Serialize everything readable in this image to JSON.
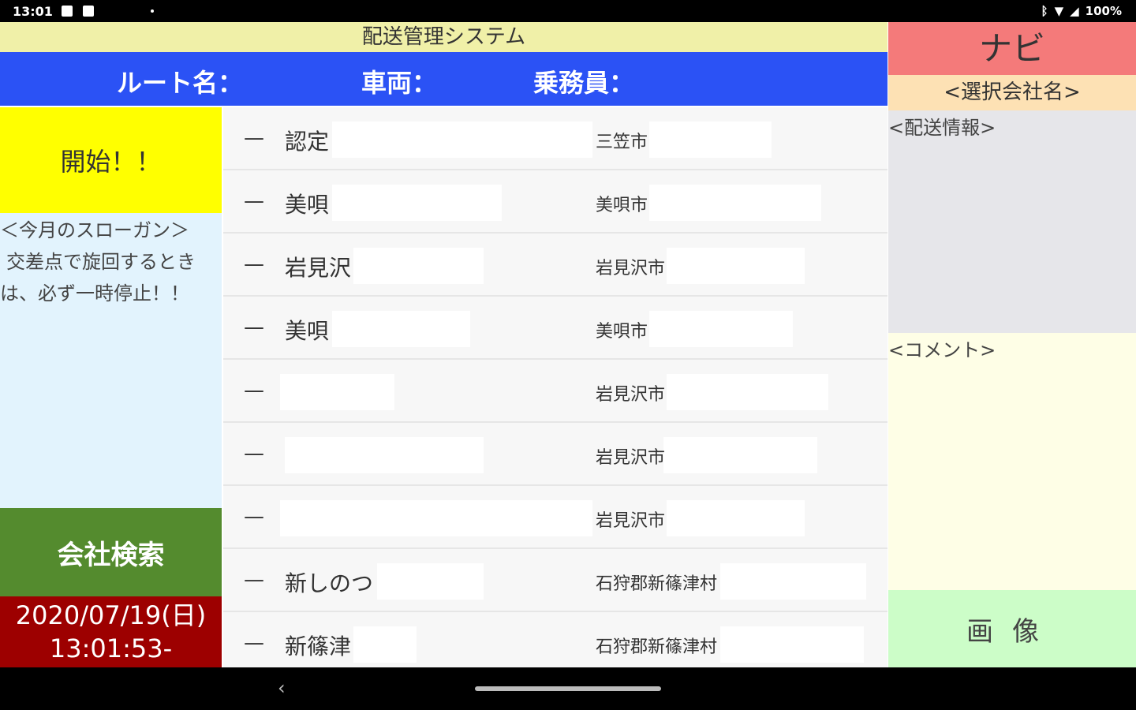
{
  "status_bar": {
    "time": "13:01",
    "battery": "100%"
  },
  "header": {
    "title": "配送管理システム",
    "route_label": "ルート名：",
    "vehicle_label": "車両：",
    "crew_label": "乗務員："
  },
  "left_panel": {
    "start_button": "開始！！",
    "slogan_title": "＜今月のスローガン＞",
    "slogan_line1": "交差点で旋回するとき",
    "slogan_line2": "は、必ず一時停止！！",
    "company_search_button": "会社検索",
    "date": "2020/07/19(日)",
    "time": "13:01:53-"
  },
  "list": {
    "rows": [
      {
        "dash": "—",
        "name": "認定",
        "city": "三笠市"
      },
      {
        "dash": "—",
        "name": "美唄",
        "city": "美唄市"
      },
      {
        "dash": "—",
        "name": "岩見沢",
        "city": "岩見沢市"
      },
      {
        "dash": "—",
        "name": "美唄",
        "city": "美唄市"
      },
      {
        "dash": "—",
        "name": "",
        "city": "岩見沢市"
      },
      {
        "dash": "—",
        "name": "",
        "city": "岩見沢市"
      },
      {
        "dash": "—",
        "name": "",
        "city": "岩見沢市"
      },
      {
        "dash": "—",
        "name": "新しのつ",
        "city": "石狩郡新篠津村"
      },
      {
        "dash": "—",
        "name": "新篠津",
        "city": "石狩郡新篠津村"
      }
    ]
  },
  "right_panel": {
    "navi_title": "ナビ",
    "selected_company": "<選択会社名>",
    "delivery_info_label": "<配送情報>",
    "comment_label": "<コメント>",
    "image_button": "画像"
  },
  "nav_bar": {
    "back_icon": "chevron-left-icon",
    "home_icon": "home-pill-icon"
  }
}
